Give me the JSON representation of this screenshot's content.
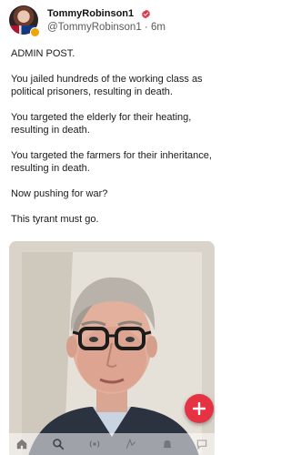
{
  "post": {
    "author": {
      "display_name": "TommyRobinson1",
      "handle": "@TommyRobinson1",
      "separator": "·",
      "time": "6m",
      "verified_icon": "verified-badge-icon",
      "verified_color": "#e53343"
    },
    "paragraphs": [
      "ADMIN POST.",
      "You jailed hundreds of the working class as political prisoners, resulting in death.",
      "You targeted the elderly for their heating, resulting in death.",
      "You targeted the farmers for their inheritance, resulting in death.",
      "Now pushing for war?",
      "This tyrant must go."
    ],
    "media": {
      "kind": "photo",
      "icon": "image-icon"
    }
  },
  "fab": {
    "icon": "plus-icon",
    "color": "#e53343"
  },
  "bottom_nav": {
    "items": [
      {
        "icon": "home-icon"
      },
      {
        "icon": "search-icon"
      },
      {
        "icon": "live-icon"
      },
      {
        "icon": "feeds-icon"
      },
      {
        "icon": "bell-icon"
      },
      {
        "icon": "chat-icon"
      }
    ]
  }
}
